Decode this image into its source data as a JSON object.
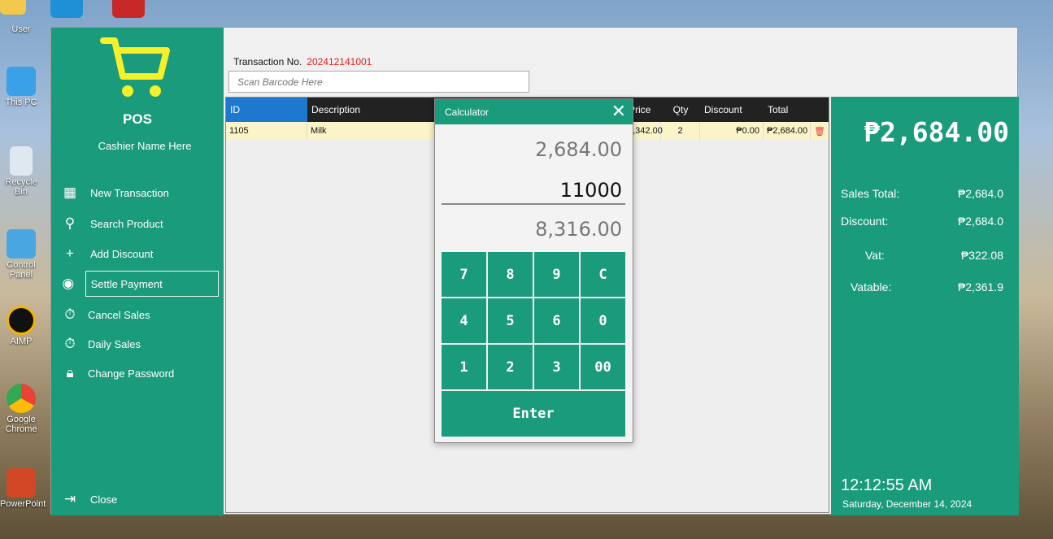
{
  "desktop": {
    "icons": [
      {
        "label": "User"
      },
      {
        "label": "This PC"
      },
      {
        "label": "Recycle Bin"
      },
      {
        "label": "Control Panel"
      },
      {
        "label": "AIMP"
      },
      {
        "label": "Google Chrome"
      },
      {
        "label": "PowerPoint"
      }
    ]
  },
  "sidebar": {
    "brand": "POS",
    "cashier": "Cashier Name Here",
    "menu": [
      {
        "label": "New Transaction",
        "icon": "table-icon"
      },
      {
        "label": "Search Product",
        "icon": "search-icon"
      },
      {
        "label": "Add Discount",
        "icon": "plus-icon"
      },
      {
        "label": "Settle Payment",
        "icon": "payment-icon"
      },
      {
        "label": "Cancel Sales",
        "icon": "timer-icon"
      },
      {
        "label": "Daily Sales",
        "icon": "timer-icon"
      },
      {
        "label": "Change Password",
        "icon": "lock-icon"
      }
    ],
    "close": "Close"
  },
  "main": {
    "transaction_label": "Transaction No.",
    "transaction_no": "202412141001",
    "scan_placeholder": "Scan Barcode Here",
    "grid": {
      "headers": [
        "ID",
        "Description",
        "Price",
        "Qty",
        "Discount",
        "Total"
      ],
      "rows": [
        {
          "id": "1105",
          "description": "Milk",
          "price": "1,342.00",
          "qty": "2",
          "discount": "₱0.00",
          "total": "₱2,684.00"
        }
      ]
    }
  },
  "summary": {
    "total": "₱2,684.00",
    "sales_total_label": "Sales Total:",
    "sales_total": "₱2,684.0",
    "discount_label": "Discount:",
    "discount": "₱2,684.0",
    "vat_label": "Vat:",
    "vat": "₱322.08",
    "vatable_label": "Vatable:",
    "vatable": "₱2,361.9",
    "time": "12:12:55 AM",
    "date": "Saturday, December 14, 2024"
  },
  "calculator": {
    "title": "Calculator",
    "amount_due": "2,684.00",
    "cash": "11000",
    "change": "8,316.00",
    "keys": [
      "7",
      "8",
      "9",
      "C",
      "4",
      "5",
      "6",
      "0",
      "1",
      "2",
      "3",
      "00"
    ],
    "enter": "Enter"
  },
  "colors": {
    "accent": "#1a9b7c",
    "cart": "#f5f02a",
    "transaction_no": "#e02020"
  }
}
